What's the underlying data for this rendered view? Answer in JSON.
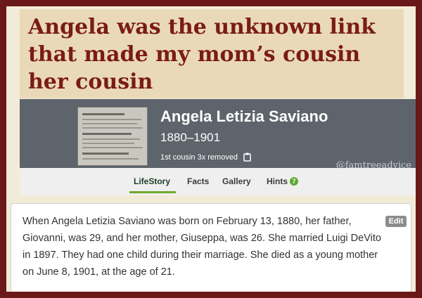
{
  "headline": {
    "line1": "Angela was the unknown link",
    "line2": "that made my mom’s cousin",
    "line3": "her cousin"
  },
  "profile": {
    "name": "Angela Letizia Saviano",
    "dates": "1880–1901",
    "relationship": "1st cousin 3x removed",
    "watermark": "@famtreeadvice"
  },
  "tabs": [
    {
      "label": "LifeStory",
      "active": true
    },
    {
      "label": "Facts"
    },
    {
      "label": "Gallery"
    },
    {
      "label": "Hints",
      "badge": "7"
    }
  ],
  "story": {
    "edit_label": "Edit",
    "text": "When Angela Letizia Saviano was born on February 13, 1880, her father, Giovanni, was 29, and her mother, Giuseppa, was 26. She married Luigi DeVito in 1897. They had one child during their marriage. She died as a young mother on June 8, 1901, at the age of 21."
  },
  "colors": {
    "frame": "#6a1818",
    "headline": "#7a1c14",
    "accent_green": "#6fa92e",
    "profile_bg": "#5d646b"
  }
}
